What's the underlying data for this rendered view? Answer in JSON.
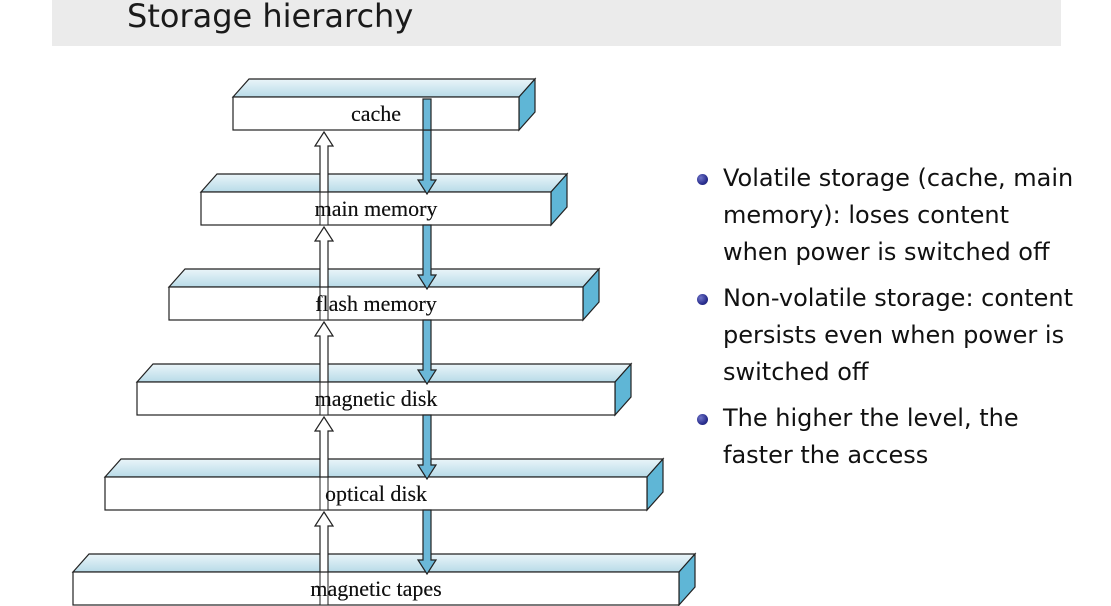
{
  "title": "Storage hierarchy",
  "levels": [
    "cache",
    "main memory",
    "flash memory",
    "magnetic disk",
    "optical disk",
    "magnetic tapes"
  ],
  "bullets": [
    "Volatile storage (cache, main memory): loses content when power is switched off",
    "Non-volatile storage: content persists even when power is switched off",
    "The higher the level, the faster the access"
  ],
  "colors": {
    "slab_top": "#cfe6ef",
    "slab_side": "#5fb6d6",
    "arrow_down": "#6bb8d8",
    "bullet": "#2a2f8f"
  }
}
